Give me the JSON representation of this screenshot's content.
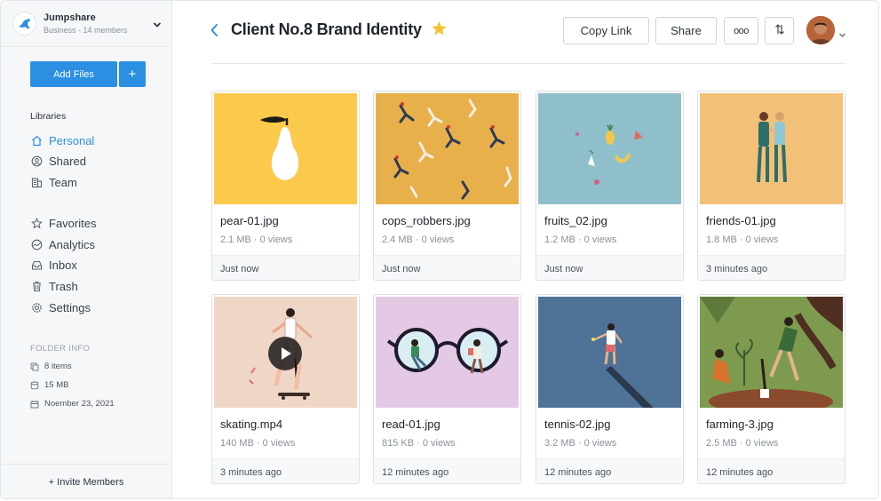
{
  "workspace": {
    "name": "Jumpshare",
    "subtitle": "Business - 14 members"
  },
  "sidebar": {
    "add_files": "Add Files",
    "add_plus": "+",
    "libraries_title": "Libraries",
    "libraries": [
      {
        "label": "Personal",
        "icon": "home-icon",
        "active": true
      },
      {
        "label": "Shared",
        "icon": "shared-icon"
      },
      {
        "label": "Team",
        "icon": "team-icon"
      }
    ],
    "links": [
      {
        "label": "Favorites",
        "icon": "star-outline-icon"
      },
      {
        "label": "Analytics",
        "icon": "analytics-icon"
      },
      {
        "label": "Inbox",
        "icon": "inbox-icon"
      },
      {
        "label": "Trash",
        "icon": "trash-icon"
      },
      {
        "label": "Settings",
        "icon": "gear-icon"
      }
    ],
    "folder_info_title": "FOLDER INFO",
    "folder_info": [
      {
        "label": "8 items",
        "icon": "items-icon"
      },
      {
        "label": "15 MB",
        "icon": "storage-icon"
      },
      {
        "label": "Noember 23, 2021",
        "icon": "calendar-icon"
      }
    ],
    "invite": "+ Invite Members"
  },
  "header": {
    "title": "Client No.8 Brand Identity",
    "copy_link": "Copy Link",
    "share": "Share",
    "more": "ooo"
  },
  "colors": {
    "accent": "#2b8fe2",
    "star": "#f2c335"
  },
  "files": [
    {
      "name": "pear-01.jpg",
      "meta": "2.1 MB · 0 views",
      "time": "Just now",
      "thumb": "pear"
    },
    {
      "name": "cops_robbers.jpg",
      "meta": "2.4 MB · 0 views",
      "time": "Just now",
      "thumb": "cops"
    },
    {
      "name": "fruits_02.jpg",
      "meta": "1.2 MB · 0 views",
      "time": "Just now",
      "thumb": "fruits"
    },
    {
      "name": "friends-01.jpg",
      "meta": "1.8 MB · 0 views",
      "time": "3 minutes ago",
      "thumb": "friends"
    },
    {
      "name": "skating.mp4",
      "meta": "140 MB · 0 views",
      "time": "3 minutes ago",
      "thumb": "skating"
    },
    {
      "name": "read-01.jpg",
      "meta": "815 KB · 0 views",
      "time": "12 minutes ago",
      "thumb": "read"
    },
    {
      "name": "tennis-02.jpg",
      "meta": "3.2 MB · 0 views",
      "time": "12 minutes ago",
      "thumb": "tennis"
    },
    {
      "name": "farming-3.jpg",
      "meta": "2.5 MB · 0 views",
      "time": "12 minutes ago",
      "thumb": "farming"
    }
  ]
}
